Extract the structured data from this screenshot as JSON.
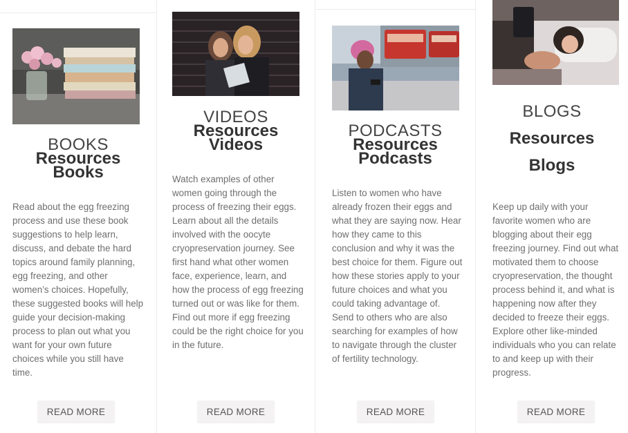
{
  "cards": [
    {
      "category": "BOOKS",
      "heading_line1": "Resources",
      "heading_line2": "Books",
      "description": "Read about the egg freezing process and use these book suggestions to help learn, discuss, and debate the hard topics around family planning, egg freezing, and other women’s choices. Hopefully, these suggested books will help guide your decision-making process to plan out what you want for your own future choices while you still have time.",
      "button": "READ MORE"
    },
    {
      "category": "VIDEOS",
      "heading_line1": "Resources",
      "heading_line2": "Videos",
      "description": "Watch examples of other women going through the process of freezing their eggs. Learn about all the details involved with the oocyte cryopreservation journey. See first hand what other women face, experience, learn, and how the process of egg freezing turned out or was like for them. Find out more if egg freezing could be the right choice for you in the future.",
      "button": "READ MORE"
    },
    {
      "category": "PODCASTS",
      "heading_line1": "Resources",
      "heading_line2": "Podcasts",
      "description": "Listen to women who have already frozen their eggs and what they are saying now. Hear how they came to this conclusion and why it was the best choice for them. Figure out how these stories apply to your future choices and what you could taking advantage of. Send to others who are also searching for examples of how to navigate through the cluster of fertility technology.",
      "button": "READ MORE"
    },
    {
      "category": "BLOGS",
      "heading_line1": "Resources",
      "heading_line2": "Blogs",
      "description": "Keep up daily with your favorite women who are blogging about their egg freezing journey. Find out what motivated them to choose cryopreservation, the thought process behind it, and what is happening now after they decided to freeze their eggs. Explore other like-minded individuals who you can relate to and keep up with their progress.",
      "button": "READ MORE"
    }
  ]
}
